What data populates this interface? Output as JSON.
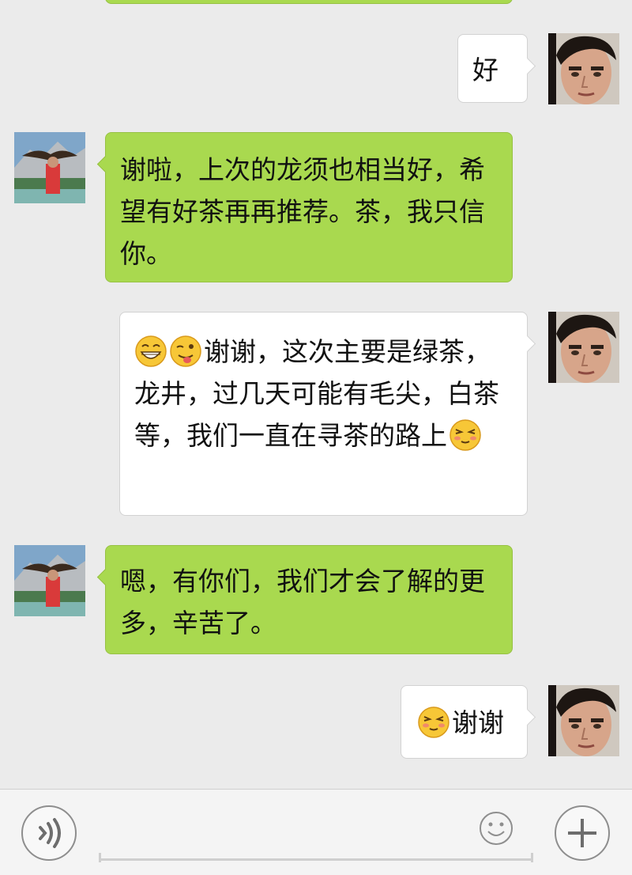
{
  "messages": [
    {
      "side": "out",
      "text": "好"
    },
    {
      "side": "in",
      "text": "谢啦，上次的龙须也相当好，希望有好茶再再推荐。茶，我只信你。"
    },
    {
      "side": "out",
      "text": "谢谢，这次主要是绿茶，龙井，过几天可能有毛尖，白茶等，我们一直在寻茶的路上",
      "emoji_before": [
        "grin-emoji",
        "wink-tongue-emoji"
      ],
      "emoji_after": [
        "shy-emoji"
      ]
    },
    {
      "side": "in",
      "text": "嗯，有你们，我们才会了解的更多，辛苦了。"
    },
    {
      "side": "out",
      "text": "谢谢",
      "emoji_before": [
        "shy-emoji"
      ]
    }
  ],
  "colors": {
    "chat_background": "#ebebeb",
    "incoming_bubble": "#a9d94f",
    "outgoing_bubble": "#ffffff",
    "input_bar": "#f4f4f4"
  },
  "input_bar": {
    "icons": [
      "voice-icon",
      "emoji-face-icon",
      "plus-icon"
    ],
    "text_value": ""
  }
}
